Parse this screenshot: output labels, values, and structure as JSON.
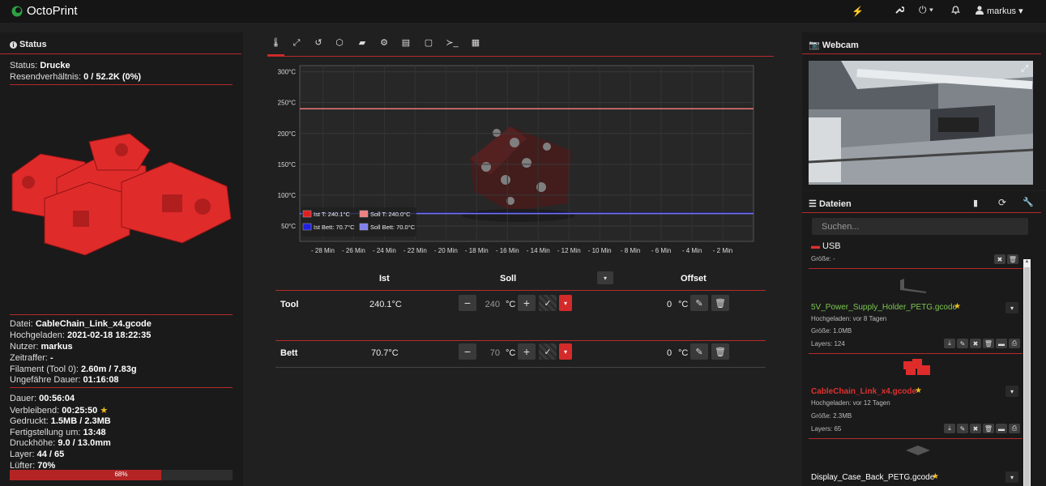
{
  "app": {
    "title": "OctoPrint",
    "user": "markus"
  },
  "colors": {
    "accent": "#d42a2a",
    "brand_green": "#2ea043",
    "bg": "#202020"
  },
  "status": {
    "heading": "Status",
    "state_label": "Status:",
    "state_value": "Drucke",
    "resend_label": "Resendverhältnis:",
    "resend_value": "0 / 52.2K (0%)",
    "file_label": "Datei:",
    "file_value": "CableChain_Link_x4.gcode",
    "uploaded_label": "Hochgeladen:",
    "uploaded_value": "2021-02-18 18:22:35",
    "user_label": "Nutzer:",
    "user_value": "markus",
    "timelapse_label": "Zeitraffer:",
    "timelapse_value": "-",
    "filament_label": "Filament (Tool 0):",
    "filament_value": "2.60m / 7.83g",
    "approx_label": "Ungefähre Dauer:",
    "approx_value": "01:16:08",
    "duration_label": "Dauer:",
    "duration_value": "00:56:04",
    "remaining_label": "Verbleibend:",
    "remaining_value": "00:25:50",
    "printed_label": "Gedruckt:",
    "printed_value": "1.5MB / 2.3MB",
    "finish_label": "Fertigstellung um:",
    "finish_value": "13:48",
    "height_label": "Druckhöhe:",
    "height_value": "9.0 / 13.0mm",
    "layer_label": "Layer:",
    "layer_value": "44 / 65",
    "fan_label": "Lüfter:",
    "fan_value": "70%",
    "progress_text": "68%",
    "progress": 0.68
  },
  "tabs": [
    "temperature",
    "control",
    "gcode-viewer",
    "3d-view",
    "files",
    "timelapse",
    "film",
    "crop",
    "terminal",
    "plugin"
  ],
  "chart_data": {
    "type": "line",
    "y_ticks": [
      "300°C",
      "250°C",
      "200°C",
      "150°C",
      "100°C",
      "50°C"
    ],
    "x_ticks": [
      "- 28 Min",
      "- 26 Min",
      "- 24 Min",
      "- 22 Min",
      "- 20 Min",
      "- 18 Min",
      "- 16 Min",
      "- 14 Min",
      "- 12 Min",
      "- 10 Min",
      "- 8 Min",
      "- 6 Min",
      "- 4 Min",
      "- 2 Min"
    ],
    "ylim": [
      25,
      310
    ],
    "xlim": [
      -29.5,
      0
    ],
    "series": [
      {
        "name": "Ist T: 240.1°C",
        "color": "#e02020",
        "values": [
          240.1,
          240.1
        ]
      },
      {
        "name": "Soll T: 240.0°C",
        "color": "#f08080",
        "values": [
          240.0,
          240.0
        ]
      },
      {
        "name": "Ist Bett: 70.7°C",
        "color": "#2020e0",
        "values": [
          70.7,
          70.7
        ]
      },
      {
        "name": "Soll Bett: 70.0°C",
        "color": "#8080f0",
        "values": [
          70.0,
          70.0
        ]
      }
    ]
  },
  "temp_table": {
    "headers": {
      "ist": "Ist",
      "soll": "Soll",
      "offset": "Offset"
    },
    "rows": [
      {
        "name": "Tool",
        "actual": "240.1°C",
        "target": "240",
        "unit": "°C",
        "offset": "0",
        "offset_unit": "°C"
      },
      {
        "name": "Bett",
        "actual": "70.7°C",
        "target": "70",
        "unit": "°C",
        "offset": "0",
        "offset_unit": "°C"
      }
    ]
  },
  "webcam": {
    "heading": "Webcam"
  },
  "files": {
    "heading": "Dateien",
    "search_placeholder": "Suchen...",
    "folder": {
      "name": "USB",
      "size_label": "Größe: -"
    },
    "items": [
      {
        "name": "5V_Power_Supply_Holder_PETG.gcode",
        "uploaded": "Hochgeladen: vor 8 Tagen",
        "size": "Größe: 1.0MB",
        "layers": "Layers: 124",
        "color": "#7ac74f"
      },
      {
        "name": "CableChain_Link_x4.gcode",
        "uploaded": "Hochgeladen: vor 12 Tagen",
        "size": "Größe: 2.3MB",
        "layers": "Layers: 65",
        "color": "#e03030"
      },
      {
        "name": "Display_Case_Back_PETG.gcode",
        "color": "#ffffff"
      }
    ]
  }
}
